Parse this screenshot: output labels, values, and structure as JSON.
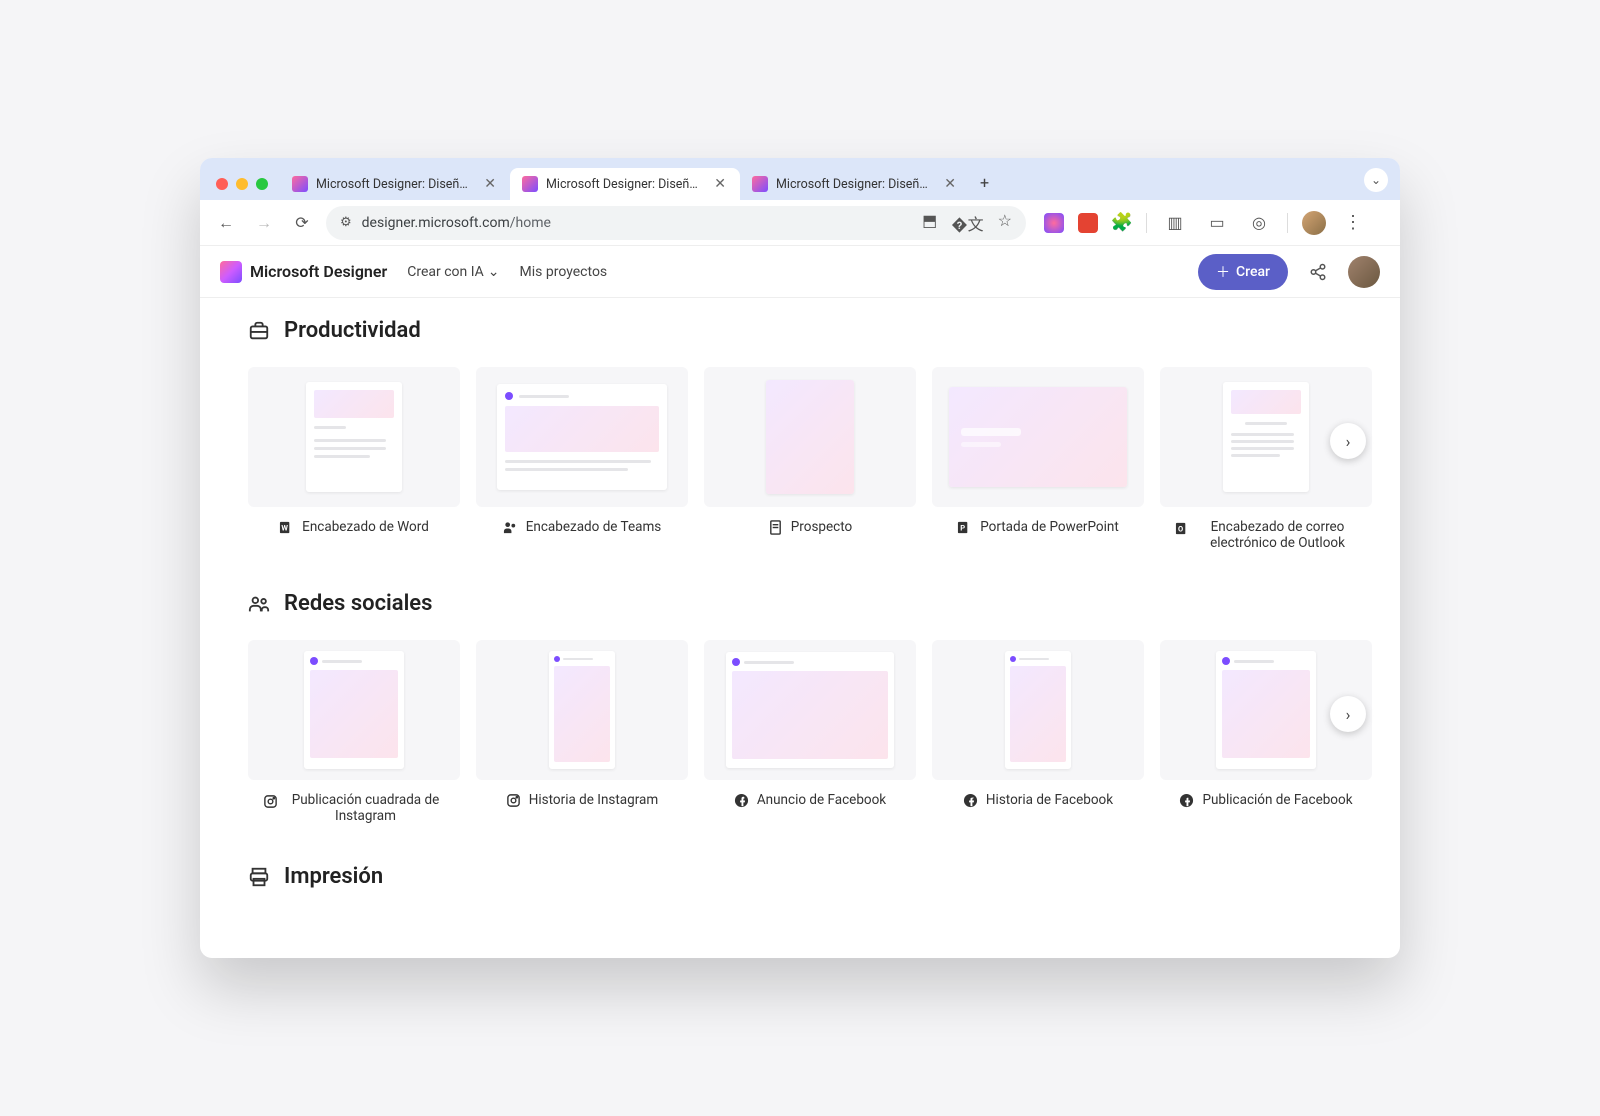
{
  "browser": {
    "tabs": [
      {
        "title": "Microsoft Designer: Diseños s",
        "active": false
      },
      {
        "title": "Microsoft Designer: Diseños s",
        "active": true
      },
      {
        "title": "Microsoft Designer: Diseños s",
        "active": false
      }
    ],
    "url_host": "designer.microsoft.com",
    "url_path": "/home"
  },
  "app": {
    "brand": "Microsoft Designer",
    "nav_create": "Crear con IA",
    "nav_projects": "Mis proyectos",
    "create_button": "Crear"
  },
  "sections": {
    "productivity": {
      "title": "Productividad",
      "items": [
        {
          "label": "Encabezado de Word",
          "icon": "word"
        },
        {
          "label": "Encabezado de Teams",
          "icon": "teams"
        },
        {
          "label": "Prospecto",
          "icon": "doc"
        },
        {
          "label": "Portada de PowerPoint",
          "icon": "ppt"
        },
        {
          "label": "Encabezado de correo electrónico de Outlook",
          "icon": "outlook"
        }
      ]
    },
    "social": {
      "title": "Redes sociales",
      "items": [
        {
          "label": "Publicación cuadrada de Instagram",
          "icon": "instagram"
        },
        {
          "label": "Historia de Instagram",
          "icon": "instagram"
        },
        {
          "label": "Anuncio de Facebook",
          "icon": "facebook"
        },
        {
          "label": "Historia de Facebook",
          "icon": "facebook"
        },
        {
          "label": "Publicación de Facebook",
          "icon": "facebook"
        }
      ]
    },
    "print": {
      "title": "Impresión"
    }
  }
}
